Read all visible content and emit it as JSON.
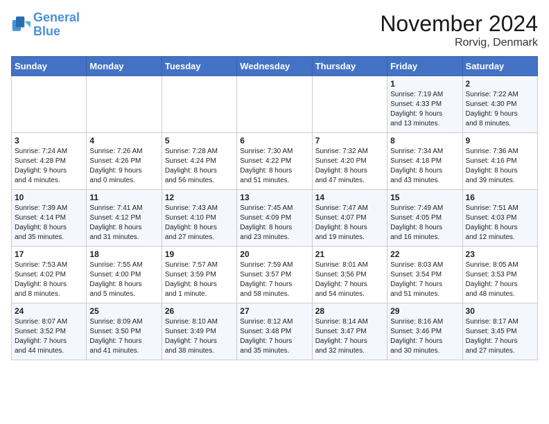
{
  "logo": {
    "line1": "General",
    "line2": "Blue"
  },
  "title": "November 2024",
  "location": "Rorvig, Denmark",
  "weekdays": [
    "Sunday",
    "Monday",
    "Tuesday",
    "Wednesday",
    "Thursday",
    "Friday",
    "Saturday"
  ],
  "weeks": [
    [
      {
        "day": "",
        "info": ""
      },
      {
        "day": "",
        "info": ""
      },
      {
        "day": "",
        "info": ""
      },
      {
        "day": "",
        "info": ""
      },
      {
        "day": "",
        "info": ""
      },
      {
        "day": "1",
        "info": "Sunrise: 7:19 AM\nSunset: 4:33 PM\nDaylight: 9 hours\nand 13 minutes."
      },
      {
        "day": "2",
        "info": "Sunrise: 7:22 AM\nSunset: 4:30 PM\nDaylight: 9 hours\nand 8 minutes."
      }
    ],
    [
      {
        "day": "3",
        "info": "Sunrise: 7:24 AM\nSunset: 4:28 PM\nDaylight: 9 hours\nand 4 minutes."
      },
      {
        "day": "4",
        "info": "Sunrise: 7:26 AM\nSunset: 4:26 PM\nDaylight: 9 hours\nand 0 minutes."
      },
      {
        "day": "5",
        "info": "Sunrise: 7:28 AM\nSunset: 4:24 PM\nDaylight: 8 hours\nand 56 minutes."
      },
      {
        "day": "6",
        "info": "Sunrise: 7:30 AM\nSunset: 4:22 PM\nDaylight: 8 hours\nand 51 minutes."
      },
      {
        "day": "7",
        "info": "Sunrise: 7:32 AM\nSunset: 4:20 PM\nDaylight: 8 hours\nand 47 minutes."
      },
      {
        "day": "8",
        "info": "Sunrise: 7:34 AM\nSunset: 4:18 PM\nDaylight: 8 hours\nand 43 minutes."
      },
      {
        "day": "9",
        "info": "Sunrise: 7:36 AM\nSunset: 4:16 PM\nDaylight: 8 hours\nand 39 minutes."
      }
    ],
    [
      {
        "day": "10",
        "info": "Sunrise: 7:39 AM\nSunset: 4:14 PM\nDaylight: 8 hours\nand 35 minutes."
      },
      {
        "day": "11",
        "info": "Sunrise: 7:41 AM\nSunset: 4:12 PM\nDaylight: 8 hours\nand 31 minutes."
      },
      {
        "day": "12",
        "info": "Sunrise: 7:43 AM\nSunset: 4:10 PM\nDaylight: 8 hours\nand 27 minutes."
      },
      {
        "day": "13",
        "info": "Sunrise: 7:45 AM\nSunset: 4:09 PM\nDaylight: 8 hours\nand 23 minutes."
      },
      {
        "day": "14",
        "info": "Sunrise: 7:47 AM\nSunset: 4:07 PM\nDaylight: 8 hours\nand 19 minutes."
      },
      {
        "day": "15",
        "info": "Sunrise: 7:49 AM\nSunset: 4:05 PM\nDaylight: 8 hours\nand 16 minutes."
      },
      {
        "day": "16",
        "info": "Sunrise: 7:51 AM\nSunset: 4:03 PM\nDaylight: 8 hours\nand 12 minutes."
      }
    ],
    [
      {
        "day": "17",
        "info": "Sunrise: 7:53 AM\nSunset: 4:02 PM\nDaylight: 8 hours\nand 8 minutes."
      },
      {
        "day": "18",
        "info": "Sunrise: 7:55 AM\nSunset: 4:00 PM\nDaylight: 8 hours\nand 5 minutes."
      },
      {
        "day": "19",
        "info": "Sunrise: 7:57 AM\nSunset: 3:59 PM\nDaylight: 8 hours\nand 1 minute."
      },
      {
        "day": "20",
        "info": "Sunrise: 7:59 AM\nSunset: 3:57 PM\nDaylight: 7 hours\nand 58 minutes."
      },
      {
        "day": "21",
        "info": "Sunrise: 8:01 AM\nSunset: 3:56 PM\nDaylight: 7 hours\nand 54 minutes."
      },
      {
        "day": "22",
        "info": "Sunrise: 8:03 AM\nSunset: 3:54 PM\nDaylight: 7 hours\nand 51 minutes."
      },
      {
        "day": "23",
        "info": "Sunrise: 8:05 AM\nSunset: 3:53 PM\nDaylight: 7 hours\nand 48 minutes."
      }
    ],
    [
      {
        "day": "24",
        "info": "Sunrise: 8:07 AM\nSunset: 3:52 PM\nDaylight: 7 hours\nand 44 minutes."
      },
      {
        "day": "25",
        "info": "Sunrise: 8:09 AM\nSunset: 3:50 PM\nDaylight: 7 hours\nand 41 minutes."
      },
      {
        "day": "26",
        "info": "Sunrise: 8:10 AM\nSunset: 3:49 PM\nDaylight: 7 hours\nand 38 minutes."
      },
      {
        "day": "27",
        "info": "Sunrise: 8:12 AM\nSunset: 3:48 PM\nDaylight: 7 hours\nand 35 minutes."
      },
      {
        "day": "28",
        "info": "Sunrise: 8:14 AM\nSunset: 3:47 PM\nDaylight: 7 hours\nand 32 minutes."
      },
      {
        "day": "29",
        "info": "Sunrise: 8:16 AM\nSunset: 3:46 PM\nDaylight: 7 hours\nand 30 minutes."
      },
      {
        "day": "30",
        "info": "Sunrise: 8:17 AM\nSunset: 3:45 PM\nDaylight: 7 hours\nand 27 minutes."
      }
    ]
  ]
}
